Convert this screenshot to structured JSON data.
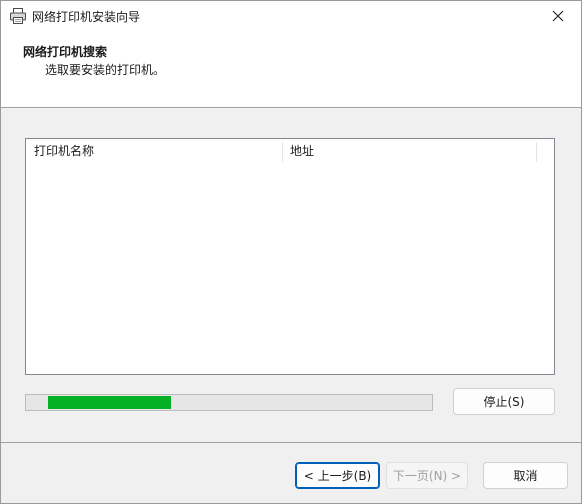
{
  "window": {
    "title": "网络打印机安装向导"
  },
  "header": {
    "title": "网络打印机搜索",
    "subtitle": "选取要安装的打印机。"
  },
  "list": {
    "columns": [
      "打印机名称",
      "地址"
    ],
    "rows": []
  },
  "progress": {
    "value_fraction": 0.32,
    "color": "#06b025"
  },
  "buttons": {
    "stop": "停止(S)",
    "back": "< 上一步(B)",
    "next": "下一页(N) >",
    "cancel": "取消"
  },
  "icons": {
    "app": "printer-icon",
    "close": "close-icon"
  }
}
